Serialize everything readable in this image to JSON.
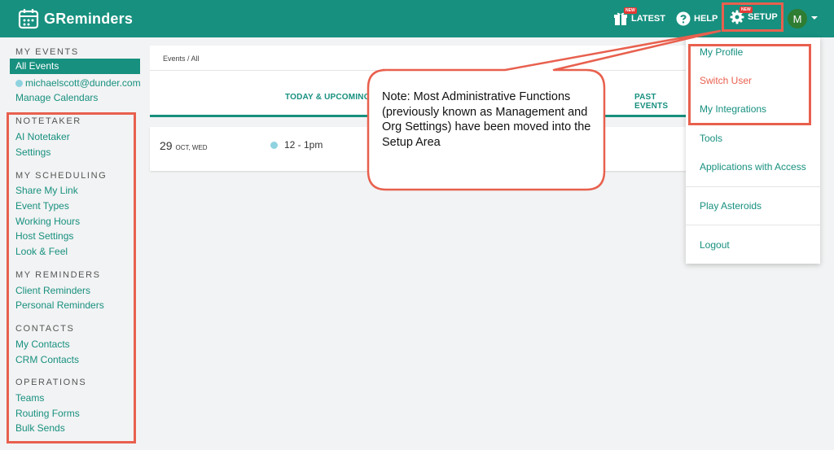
{
  "app": {
    "name": "GReminders",
    "avatar_initial": "M"
  },
  "topnav": {
    "latest": {
      "label": "LATEST",
      "badge": "NEW"
    },
    "help": {
      "label": "HELP"
    },
    "setup": {
      "label": "SETUP",
      "badge": "NEW"
    }
  },
  "sidebar": {
    "my_events": {
      "heading": "MY EVENTS",
      "all_events": "All Events",
      "calendar_email": "michaelscott@dunder.com",
      "manage_calendars": "Manage Calendars"
    },
    "sections": [
      {
        "heading": "NOTETAKER",
        "items": [
          "AI Notetaker",
          "Settings"
        ]
      },
      {
        "heading": "MY SCHEDULING",
        "items": [
          "Share My Link",
          "Event Types",
          "Working Hours",
          "Host Settings",
          "Look & Feel"
        ]
      },
      {
        "heading": "MY REMINDERS",
        "items": [
          "Client Reminders",
          "Personal Reminders"
        ]
      },
      {
        "heading": "CONTACTS",
        "items": [
          "My Contacts",
          "CRM Contacts"
        ]
      },
      {
        "heading": "OPERATIONS",
        "items": [
          "Teams",
          "Routing Forms",
          "Bulk Sends"
        ]
      }
    ]
  },
  "main": {
    "breadcrumb": "Events / All",
    "tabs": {
      "today": "TODAY & UPCOMING",
      "past": "PAST EVENTS"
    },
    "event": {
      "day": "29",
      "month_weekday": "OCT, WED",
      "time": "12 - 1pm"
    }
  },
  "dropdown": {
    "items": [
      "My Profile",
      "Switch User",
      "My Integrations",
      "Tools",
      "Applications with Access",
      "Play Asteroids",
      "Logout"
    ]
  },
  "callout": {
    "text": "Note: Most Administrative Functions (previously known as Management and Org Settings) have been moved into the Setup Area"
  },
  "colors": {
    "brand": "#17907f",
    "highlight": "#e8604e",
    "calendar_dot": "#8fd3e0"
  }
}
